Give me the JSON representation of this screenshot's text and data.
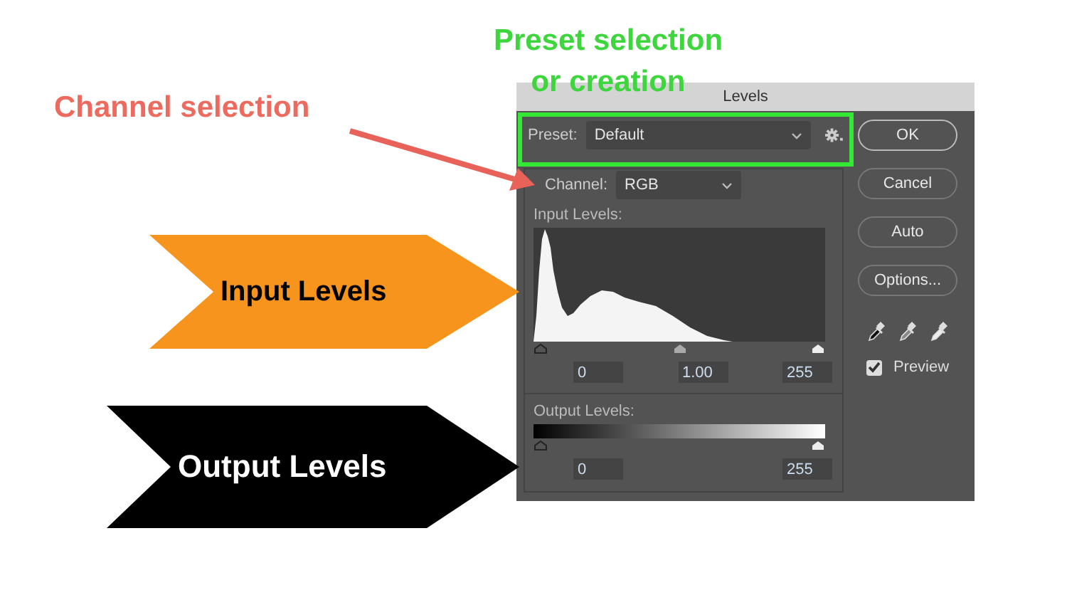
{
  "annotations": {
    "preset_callout": [
      "Preset selection",
      "or creation"
    ],
    "channel_callout": "Channel selection",
    "input_arrow": "Input Levels",
    "output_arrow": "Output Levels"
  },
  "dialog": {
    "title": "Levels",
    "preset": {
      "label": "Preset:",
      "value": "Default"
    },
    "channel": {
      "label": "Channel:",
      "value": "RGB"
    },
    "input_levels": {
      "label": "Input Levels:",
      "fields": [
        "0",
        "1.00",
        "255"
      ]
    },
    "output_levels": {
      "label": "Output Levels:",
      "fields": [
        "0",
        "255"
      ]
    },
    "buttons": [
      {
        "label": "OK",
        "default": true
      },
      {
        "label": "Cancel",
        "default": false
      },
      {
        "label": "Auto",
        "default": false
      },
      {
        "label": "Options...",
        "default": false
      }
    ],
    "preview": {
      "label": "Preview",
      "checked": true
    }
  }
}
